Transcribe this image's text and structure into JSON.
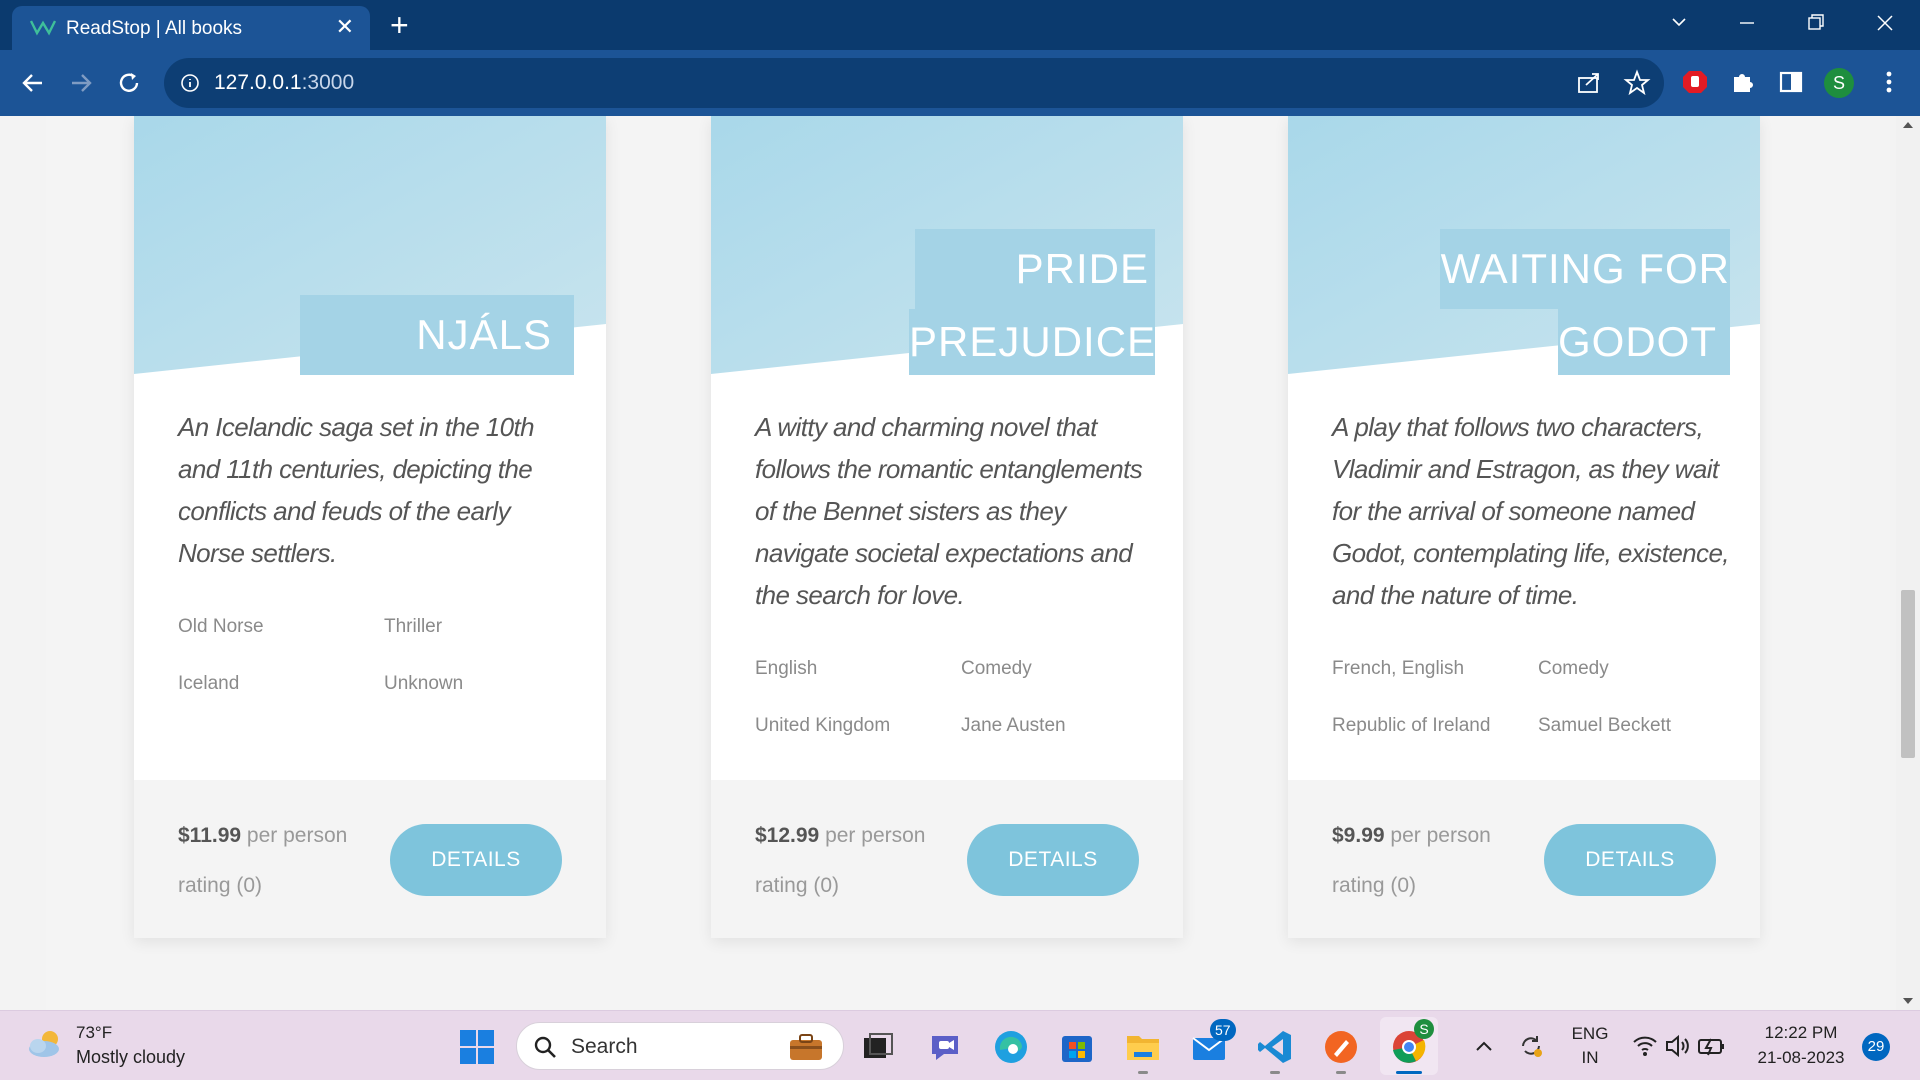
{
  "browser": {
    "tab_title": "ReadStop | All books",
    "tab_close": "✕",
    "new_tab": "+",
    "url_host": "127.0.0.1",
    "url_port": ":3000",
    "profile_initial": "S"
  },
  "books": [
    {
      "title_lines": [
        "NJÁLS SAGA"
      ],
      "description": "An Icelandic saga set in the 10th and 11th centuries, depicting the conflicts and feuds of the early Norse settlers.",
      "language": "Old Norse",
      "genre": "Thriller",
      "country": "Iceland",
      "author": "Unknown",
      "price": "$11.99",
      "price_unit": "per person",
      "rating": "rating (0)",
      "button": "DETAILS"
    },
    {
      "title_lines": [
        "PRIDE AND",
        "PREJUDICE"
      ],
      "description": "A witty and charming novel that follows the romantic entanglements of the Bennet sisters as they navigate societal expectations and the search for love.",
      "language": "English",
      "genre": "Comedy",
      "country": "United Kingdom",
      "author": "Jane Austen",
      "price": "$12.99",
      "price_unit": "per person",
      "rating": "rating (0)",
      "button": "DETAILS"
    },
    {
      "title_lines": [
        "WAITING FOR",
        "GODOT"
      ],
      "description": "A play that follows two characters, Vladimir and Estragon, as they wait for the arrival of someone named Godot, contemplating life, existence, and the nature of time.",
      "language": "French, English",
      "genre": "Comedy",
      "country": "Republic of Ireland",
      "author": "Samuel Beckett",
      "price": "$9.99",
      "price_unit": "per person",
      "rating": "rating (0)",
      "button": "DETAILS"
    }
  ],
  "taskbar": {
    "weather_temp": "73°F",
    "weather_desc": "Mostly cloudy",
    "search_label": "Search",
    "mail_badge": "57",
    "lang_top": "ENG",
    "lang_bottom": "IN",
    "time": "12:22 PM",
    "date": "21-08-2023",
    "notifications": "29"
  },
  "colors": {
    "accent": "#7ec4dc",
    "title_bg": "#a4d3e6",
    "chrome_dark": "#0b3a6e",
    "chrome": "#1c5496"
  }
}
